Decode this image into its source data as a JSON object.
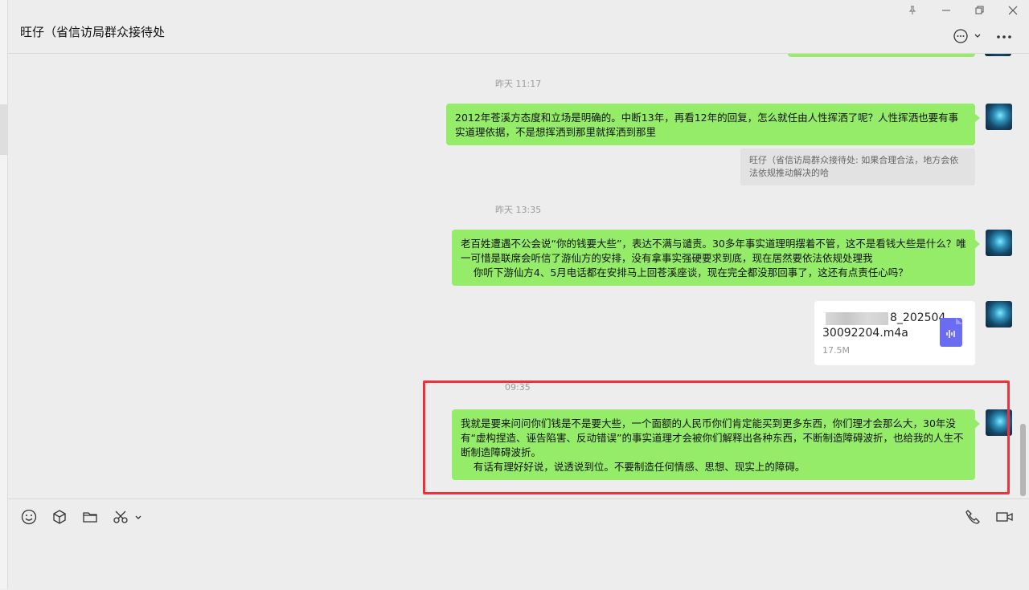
{
  "window": {
    "title": "旺仔（省信访局群众接待处",
    "pin_icon": "pin-icon",
    "minimize_icon": "minimize-icon",
    "maximize_icon": "maximize-icon",
    "close_icon": "close-icon"
  },
  "header_actions": {
    "chat_icon": "chat-bubble-icon",
    "more_icon": "more-dots-icon"
  },
  "messages": [
    {
      "time": "昨天 11:17",
      "text": "2012年苍溪方态度和立场是明确的。中断13年，再看12年的回复，怎么就任由人性挥洒了呢？人性挥洒也要有事实道理依据，不是想挥洒到那里就挥洒到那里",
      "quote": "旺仔（省信访局群众接待处: 如果合理合法，地方会依法依规推动解决的哈"
    },
    {
      "time": "昨天 13:35",
      "text_lines": [
        "老百姓遭遇不公会说“你的钱要大些”，表达不满与谴责。30多年事实道理明摆着不管，这不是看钱大些是什么？唯一可惜是联席会听信了游仙方的安排，没有拿事实强硬要求到底，现在居然要依法依规处理我",
        "    你听下游仙方4、5月电话都在安排马上回苍溪座谈，现在完全都没那回事了，这还有点责任心吗？"
      ]
    },
    {
      "file": {
        "name_part1": "8_202504",
        "name_part2": "30092204.m4a",
        "size": "17.5M",
        "icon": "audio-file-icon"
      }
    },
    {
      "time": "09:35",
      "text_lines": [
        "我就是要来问问你们钱是不是要大些，一个面额的人民币你们肯定能买到更多东西，你们理才会那么大，30年没有“虚构捏造、诬告陷害、反动错误”的事实道理才会被你们解释出各种东西，不断制造障碍波折，也给我的人生不断制造障碍波折。",
        "    有话有理好好说，说透说到位。不要制造任何情感、思想、现实上的障碍。"
      ]
    }
  ],
  "toolbar": {
    "emoji_icon": "emoji-icon",
    "sticker_icon": "box-icon",
    "folder_icon": "folder-icon",
    "scissors_icon": "scissors-icon",
    "phone_icon": "phone-icon",
    "video_icon": "video-icon"
  },
  "colors": {
    "bubble": "#95ec69",
    "highlight": "#f0303a",
    "background": "#ededed"
  }
}
